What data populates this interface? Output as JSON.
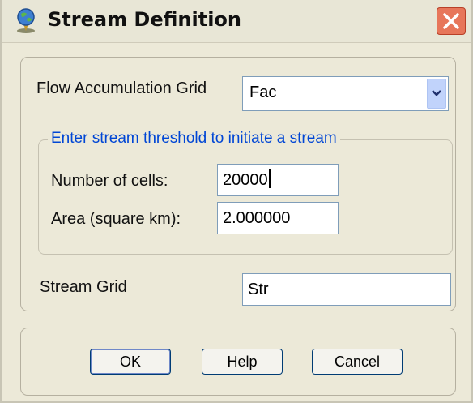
{
  "window": {
    "title": "Stream Definition",
    "app_icon": "globe-pin-icon",
    "close_icon": "close-icon"
  },
  "form": {
    "flow_acc_label": "Flow Accumulation Grid",
    "flow_acc_value": "Fac",
    "threshold_legend": "Enter stream threshold to initiate a stream",
    "cells_label": "Number of cells:",
    "cells_value": "20000",
    "area_label": "Area (square km):",
    "area_value": "2.000000",
    "stream_grid_label": "Stream Grid",
    "stream_grid_value": "Str"
  },
  "buttons": {
    "ok": "OK",
    "help": "Help",
    "cancel": "Cancel"
  },
  "colors": {
    "dialog_bg": "#ECE9D8",
    "legend_text": "#0046D5",
    "close_button": "#E7765A"
  }
}
